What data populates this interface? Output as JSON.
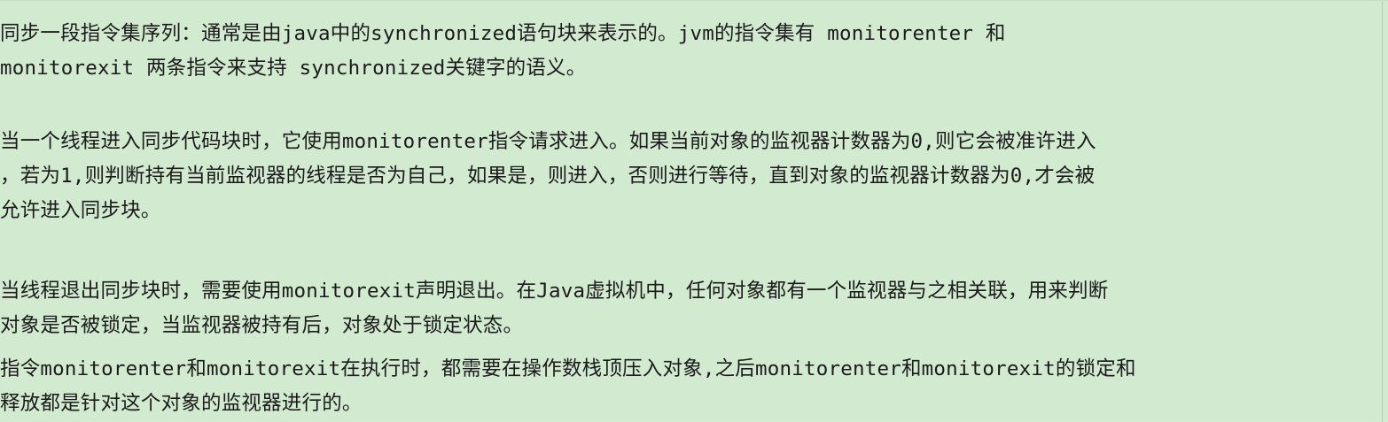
{
  "paragraphs": [
    {
      "lines": [
        "同步一段指令集序列：通常是由java中的synchronized语句块来表示的。jvm的指令集有 monitorenter 和",
        "monitorexit 两条指令来支持 synchronized关键字的语义。"
      ]
    },
    {
      "lines": [
        "当一个线程进入同步代码块时，它使用monitorenter指令请求进入。如果当前对象的监视器计数器为0,则它会被准许进入",
        "，若为1,则判断持有当前监视器的线程是否为自己，如果是，则进入，否则进行等待，直到对象的监视器计数器为0,才会被",
        "允许进入同步块。"
      ]
    },
    {
      "lines": [
        "当线程退出同步块时，需要使用monitorexit声明退出。在Java虚拟机中，任何对象都有一个监视器与之相关联，用来判断",
        "对象是否被锁定，当监视器被持有后，对象处于锁定状态。"
      ]
    },
    {
      "lines": [
        "指令monitorenter和monitorexit在执行时，都需要在操作数栈顶压入对象,之后monitorenter和monitorexit的锁定和",
        "释放都是针对这个对象的监视器进行的。"
      ]
    }
  ]
}
